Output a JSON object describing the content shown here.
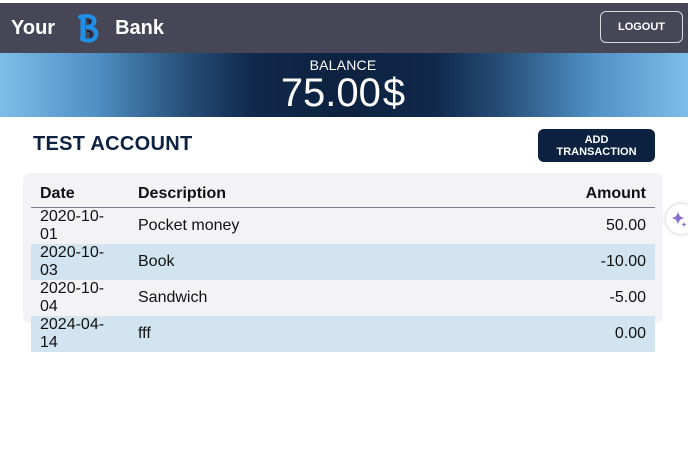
{
  "header": {
    "brand_left": "Your",
    "brand_right": "Bank",
    "logout_label": "LOGOUT",
    "colors": {
      "bar": "#474657",
      "logo": "#1f8fe8"
    },
    "logo_icon": "stylized-b-logo-icon"
  },
  "balance": {
    "label": "BALANCE",
    "amount": "75.00",
    "currency": "$"
  },
  "account": {
    "title": "TEST ACCOUNT",
    "add_transaction_label": "ADD TRANSACTION"
  },
  "table": {
    "headers": {
      "date": "Date",
      "description": "Description",
      "amount": "Amount"
    },
    "rows": [
      {
        "date": "2020-10-01",
        "description": "Pocket money",
        "amount": "50.00"
      },
      {
        "date": "2020-10-03",
        "description": "Book",
        "amount": "-10.00"
      },
      {
        "date": "2020-10-04",
        "description": "Sandwich",
        "amount": "-5.00"
      },
      {
        "date": "2024-04-14",
        "description": "fff",
        "amount": "0.00"
      }
    ],
    "colors": {
      "row_even": "#d1e4f0",
      "row_odd": "#f3f3f5"
    }
  },
  "overlay": {
    "icon": "sparkle-icon",
    "color": "#8a6fd1"
  }
}
